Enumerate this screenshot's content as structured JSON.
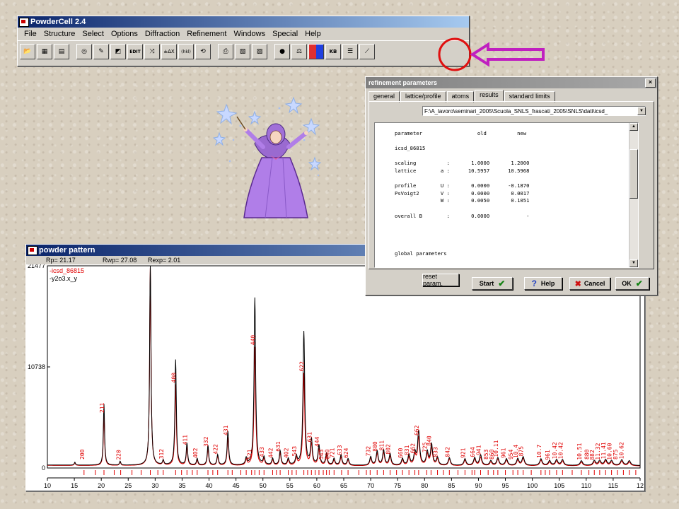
{
  "app": {
    "title": "PowderCell 2.4"
  },
  "menu": [
    "File",
    "Structure",
    "Select",
    "Options",
    "Diffraction",
    "Refinement",
    "Windows",
    "Special",
    "Help"
  ],
  "toolbar_icons": [
    "open-icon",
    "save-icon",
    "clipboard-icon",
    "atom-icon",
    "wand-icon",
    "edit-structure-icon",
    "edit-icon",
    "transform-icon",
    "delta-icon",
    "hkl-icon",
    "rotate-icon",
    "print-icon",
    "print-preview-icon",
    "export-icon",
    "sphere-icon",
    "balance-icon",
    "color-icon",
    "kb-icon",
    "stack-icon",
    "refinement-icon"
  ],
  "toolbar_labels": {
    "edit": "EDIT",
    "delta": "±ΔX",
    "hkl": "(hkl)",
    "kb": "KB"
  },
  "highlight": {
    "circle_color": "#e01010",
    "arrow_color": "#c020c0"
  },
  "refine": {
    "title": "refinement parameters",
    "close": "×",
    "tabs": [
      "general",
      "lattice/profile",
      "atoms",
      "results",
      "standard limits"
    ],
    "selected_tab": "results",
    "path": "F:\\A_lavoro\\seminari_2005\\Scuola_SNLS_frascati_2005\\SNLS\\dati\\icsd_",
    "results_text": "parameter                  old          new\n\nicsd_86815\n\nscaling          :       1.0000       1.2000\nlattice        a :      10.5957      10.5968\n\nprofile        U :       0.0000      -0.1870\nPsVoigt2       V :       0.0000       0.0017\n               W :       0.0050       0.1051\n\noverall B        :       0.0000            -\n\n\n\n\nglobal parameters",
    "buttons": {
      "reset": "reset param.",
      "start": "Start",
      "help": "Help",
      "cancel": "Cancel",
      "ok": "OK"
    },
    "button_marks": {
      "start": "✔",
      "help": "?",
      "cancel": "✖",
      "ok": "✔"
    }
  },
  "pattern": {
    "title": "powder pattern",
    "rp": "Rp= 21.17",
    "rwp": "Rwp= 27.08",
    "rexp": "Rexp= 2.01"
  },
  "chart_data": {
    "type": "line",
    "ylim": [
      0,
      21477
    ],
    "xlim": [
      10,
      120
    ],
    "y_ticks": [
      "21477",
      "10738",
      "0"
    ],
    "x_ticks": [
      "10",
      "15",
      "20",
      "25",
      "30",
      "35",
      "40",
      "45",
      "50",
      "55",
      "60",
      "65",
      "70",
      "75",
      "80",
      "85",
      "90",
      "95",
      "100",
      "105",
      "110",
      "115",
      "12"
    ],
    "legend": [
      {
        "name": "-icsd_86815",
        "color": "#e00000"
      },
      {
        "name": "-y2o3.x_y",
        "color": "#000000"
      }
    ],
    "series": [
      {
        "name": "y2o3.x_y",
        "color": "#000000",
        "peaks": [
          [
            15.1,
            300
          ],
          [
            20.5,
            6500
          ],
          [
            23.5,
            400
          ],
          [
            29.1,
            21477
          ],
          [
            31.5,
            500
          ],
          [
            33.8,
            11200
          ],
          [
            35.9,
            2300
          ],
          [
            37.8,
            700
          ],
          [
            39.8,
            2100
          ],
          [
            41.6,
            1100
          ],
          [
            43.5,
            3600
          ],
          [
            46.9,
            700
          ],
          [
            48.5,
            17800
          ],
          [
            50.2,
            800
          ],
          [
            51.8,
            700
          ],
          [
            53.2,
            1500
          ],
          [
            54.7,
            700
          ],
          [
            56.2,
            900
          ],
          [
            57.6,
            14200
          ],
          [
            59.0,
            2700
          ],
          [
            60.4,
            2100
          ],
          [
            61.8,
            1200
          ],
          [
            63.2,
            700
          ],
          [
            64.5,
            1100
          ],
          [
            65.8,
            700
          ],
          [
            70.0,
            900
          ],
          [
            71.2,
            1500
          ],
          [
            72.4,
            1600
          ],
          [
            73.6,
            1200
          ],
          [
            75.9,
            700
          ],
          [
            77.1,
            1100
          ],
          [
            78.2,
            1300
          ],
          [
            78.9,
            3600
          ],
          [
            80.5,
            1400
          ],
          [
            81.3,
            2200
          ],
          [
            82.4,
            800
          ],
          [
            84.6,
            800
          ],
          [
            87.5,
            700
          ],
          [
            89.3,
            800
          ],
          [
            90.4,
            1100
          ],
          [
            92.3,
            500
          ],
          [
            93.6,
            800
          ],
          [
            95.2,
            700
          ],
          [
            97.3,
            700
          ],
          [
            98.3,
            900
          ],
          [
            101.6,
            700
          ],
          [
            103.2,
            500
          ],
          [
            104.5,
            600
          ],
          [
            105.6,
            600
          ],
          [
            109.1,
            500
          ],
          [
            111.5,
            500
          ],
          [
            112.5,
            500
          ],
          [
            113.6,
            600
          ],
          [
            114.7,
            500
          ],
          [
            116.6,
            600
          ],
          [
            118.0,
            500
          ]
        ]
      },
      {
        "name": "icsd_86815",
        "color": "#e00000",
        "peaks": [
          [
            15.1,
            300
          ],
          [
            20.5,
            5400
          ],
          [
            23.5,
            400
          ],
          [
            29.1,
            21000
          ],
          [
            31.5,
            500
          ],
          [
            33.8,
            8600
          ],
          [
            35.9,
            2000
          ],
          [
            37.8,
            600
          ],
          [
            39.8,
            1800
          ],
          [
            41.6,
            1000
          ],
          [
            43.5,
            3000
          ],
          [
            46.9,
            600
          ],
          [
            48.5,
            12600
          ],
          [
            50.2,
            700
          ],
          [
            51.8,
            600
          ],
          [
            53.2,
            1300
          ],
          [
            54.7,
            600
          ],
          [
            56.2,
            800
          ],
          [
            57.6,
            9800
          ],
          [
            59.0,
            2300
          ],
          [
            60.4,
            1800
          ],
          [
            61.8,
            1000
          ],
          [
            63.2,
            600
          ],
          [
            64.5,
            900
          ],
          [
            65.8,
            600
          ],
          [
            70.0,
            800
          ],
          [
            71.2,
            1300
          ],
          [
            72.4,
            1400
          ],
          [
            73.6,
            1000
          ],
          [
            75.9,
            600
          ],
          [
            77.1,
            900
          ],
          [
            78.2,
            1100
          ],
          [
            78.9,
            3000
          ],
          [
            80.5,
            1200
          ],
          [
            81.3,
            1900
          ],
          [
            82.4,
            700
          ],
          [
            84.6,
            700
          ],
          [
            87.5,
            600
          ],
          [
            89.3,
            700
          ],
          [
            90.4,
            900
          ],
          [
            92.3,
            400
          ],
          [
            93.6,
            700
          ],
          [
            95.2,
            600
          ],
          [
            97.3,
            600
          ],
          [
            98.3,
            800
          ],
          [
            101.6,
            600
          ],
          [
            103.2,
            400
          ],
          [
            104.5,
            500
          ],
          [
            105.6,
            500
          ],
          [
            109.1,
            400
          ],
          [
            111.5,
            400
          ],
          [
            112.5,
            400
          ],
          [
            113.6,
            500
          ],
          [
            114.7,
            400
          ],
          [
            116.6,
            500
          ],
          [
            118.0,
            400
          ]
        ]
      }
    ],
    "hkl_labels": [
      [
        16.8,
        "200"
      ],
      [
        20.5,
        "211"
      ],
      [
        23.6,
        "220"
      ],
      [
        31.5,
        "312"
      ],
      [
        33.8,
        "400"
      ],
      [
        35.9,
        "411"
      ],
      [
        37.8,
        "402"
      ],
      [
        39.8,
        "332"
      ],
      [
        41.6,
        "422"
      ],
      [
        43.5,
        "431"
      ],
      [
        47.9,
        "521"
      ],
      [
        48.5,
        "440"
      ],
      [
        50.2,
        "433"
      ],
      [
        51.8,
        "442"
      ],
      [
        53.2,
        "631"
      ],
      [
        54.7,
        "402"
      ],
      [
        56.2,
        "543"
      ],
      [
        57.6,
        "622"
      ],
      [
        59.0,
        "631"
      ],
      [
        60.4,
        "444"
      ],
      [
        61.2,
        "543"
      ],
      [
        62.3,
        "640"
      ],
      [
        63.2,
        "721"
      ],
      [
        64.6,
        "633"
      ],
      [
        65.8,
        "624"
      ],
      [
        69.9,
        "732"
      ],
      [
        71.2,
        "800"
      ],
      [
        72.4,
        "811"
      ],
      [
        73.6,
        "802"
      ],
      [
        75.9,
        "660"
      ],
      [
        77.1,
        "831"
      ],
      [
        78.2,
        "662"
      ],
      [
        78.9,
        "662"
      ],
      [
        80.4,
        "725"
      ],
      [
        81.2,
        "840"
      ],
      [
        82.4,
        "833"
      ],
      [
        84.6,
        "842"
      ],
      [
        87.5,
        "921"
      ],
      [
        89.3,
        "664"
      ],
      [
        90.4,
        "941"
      ],
      [
        91.8,
        "853"
      ],
      [
        92.8,
        "860"
      ],
      [
        93.6,
        "10.11"
      ],
      [
        95.0,
        "961"
      ],
      [
        96.4,
        "954"
      ],
      [
        97.3,
        "10.4"
      ],
      [
        98.3,
        "875"
      ],
      [
        101.6,
        "10.7"
      ],
      [
        103.2,
        "961"
      ],
      [
        104.5,
        "10.42"
      ],
      [
        105.6,
        "10.42"
      ],
      [
        109.1,
        "10.51"
      ],
      [
        110.5,
        "880"
      ],
      [
        111.5,
        "882"
      ],
      [
        112.5,
        "11.32"
      ],
      [
        113.6,
        "11.41"
      ],
      [
        114.7,
        "10.60"
      ],
      [
        115.8,
        "875"
      ],
      [
        116.9,
        "10.62"
      ]
    ],
    "reflection_ticks": [
      16.8,
      18.9,
      20.5,
      22.4,
      23.6,
      25.7,
      27.4,
      29.1,
      30.5,
      31.5,
      33.8,
      34.9,
      35.9,
      36.9,
      37.8,
      39.8,
      40.7,
      41.6,
      43.5,
      44.3,
      45.9,
      46.9,
      47.9,
      48.5,
      49.3,
      50.2,
      51.8,
      52.5,
      53.2,
      54.7,
      55.4,
      56.2,
      57.6,
      58.3,
      59.0,
      59.7,
      60.4,
      61.2,
      61.8,
      62.3,
      63.2,
      64.6,
      65.8,
      67.8,
      69.2,
      69.9,
      71.2,
      72.4,
      73.6,
      74.8,
      75.9,
      77.1,
      78.2,
      78.9,
      80.4,
      81.2,
      82.4,
      83.5,
      84.6,
      86.2,
      87.5,
      88.8,
      89.3,
      90.4,
      91.8,
      92.8,
      93.6,
      95.0,
      96.4,
      97.3,
      98.3,
      99.8,
      101.6,
      102.4,
      103.2,
      104.5,
      105.6,
      107.4,
      109.1,
      110.5,
      111.5,
      112.5,
      113.6,
      114.7,
      115.8,
      116.9,
      118.0,
      119.2
    ]
  }
}
